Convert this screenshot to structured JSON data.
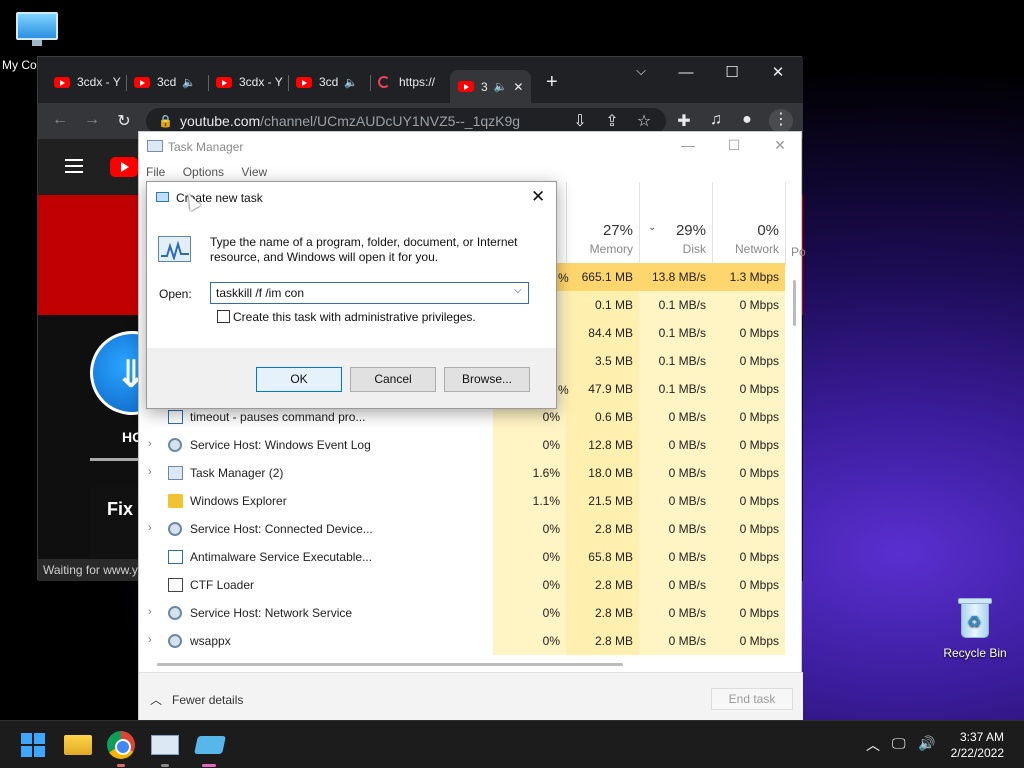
{
  "desktop": {
    "my_computer_label": "My Co",
    "recycle_bin_label": "Recycle Bin"
  },
  "chrome": {
    "tabs": [
      {
        "label": "3cdx - Y",
        "icon": "youtube-icon"
      },
      {
        "label": "3cd",
        "icon": "youtube-icon",
        "audio": true
      },
      {
        "label": "3cdx - Y",
        "icon": "youtube-icon"
      },
      {
        "label": "3cd",
        "icon": "youtube-icon",
        "audio": true
      },
      {
        "label": "https://",
        "icon": "loading-icon",
        "audio": true
      },
      {
        "label": "3",
        "icon": "youtube-icon",
        "audio": true,
        "active": true
      }
    ],
    "new_tab": "+",
    "url_host": "youtube.com",
    "url_path": "/channel/UCmzAUDcUY1NVZ5--_1qzK9g",
    "status_text": "Waiting for www.y",
    "yt_tab_home": "HO",
    "yt_video_title": "Fix Y"
  },
  "taskmgr": {
    "title": "Task Manager",
    "menu": [
      "File",
      "Options",
      "View"
    ],
    "columns": [
      {
        "pct": "27%",
        "label": "Memory"
      },
      {
        "pct": "29%",
        "label": "Disk"
      },
      {
        "pct": "0%",
        "label": "Network"
      }
    ],
    "extra_col": "Po",
    "rows": [
      {
        "name": "",
        "cpu": "",
        "mem": "665.1 MB",
        "disk": "13.8 MB/s",
        "net": "1.3 Mbps",
        "hot": true
      },
      {
        "name": "",
        "cpu": "",
        "mem": "0.1 MB",
        "disk": "0.1 MB/s",
        "net": "0 Mbps"
      },
      {
        "name": "",
        "cpu": "",
        "mem": "84.4 MB",
        "disk": "0.1 MB/s",
        "net": "0 Mbps"
      },
      {
        "name": "",
        "cpu": "",
        "mem": "3.5 MB",
        "disk": "0.1 MB/s",
        "net": "0 Mbps"
      },
      {
        "name": "",
        "cpu": "",
        "mem": "47.9 MB",
        "disk": "0.1 MB/s",
        "net": "0 Mbps"
      },
      {
        "name": "timeout - pauses command pro...",
        "cpu": "0%",
        "mem": "0.6 MB",
        "disk": "0 MB/s",
        "net": "0 Mbps",
        "exp": false,
        "icon": "console"
      },
      {
        "name": "Service Host: Windows Event Log",
        "cpu": "0%",
        "mem": "12.8 MB",
        "disk": "0 MB/s",
        "net": "0 Mbps",
        "exp": true,
        "icon": "gear"
      },
      {
        "name": "Task Manager (2)",
        "cpu": "1.6%",
        "mem": "18.0 MB",
        "disk": "0 MB/s",
        "net": "0 Mbps",
        "exp": true,
        "icon": "taskmgr"
      },
      {
        "name": "Windows Explorer",
        "cpu": "1.1%",
        "mem": "21.5 MB",
        "disk": "0 MB/s",
        "net": "0 Mbps",
        "exp": false,
        "icon": "folder"
      },
      {
        "name": "Service Host: Connected Device...",
        "cpu": "0%",
        "mem": "2.8 MB",
        "disk": "0 MB/s",
        "net": "0 Mbps",
        "exp": true,
        "icon": "gear"
      },
      {
        "name": "Antimalware Service Executable...",
        "cpu": "0%",
        "mem": "65.8 MB",
        "disk": "0 MB/s",
        "net": "0 Mbps",
        "exp": false,
        "icon": "console"
      },
      {
        "name": "CTF Loader",
        "cpu": "0%",
        "mem": "2.8 MB",
        "disk": "0 MB/s",
        "net": "0 Mbps",
        "exp": false,
        "icon": "ctf"
      },
      {
        "name": "Service Host: Network Service",
        "cpu": "0%",
        "mem": "2.8 MB",
        "disk": "0 MB/s",
        "net": "0 Mbps",
        "exp": true,
        "icon": "gear"
      },
      {
        "name": "wsappx",
        "cpu": "0%",
        "mem": "2.8 MB",
        "disk": "0 MB/s",
        "net": "0 Mbps",
        "exp": true,
        "icon": "gear"
      }
    ],
    "partial_cpu_first5": [
      "%",
      "",
      "",
      "",
      "%"
    ],
    "fewer_details": "Fewer details",
    "end_task": "End task"
  },
  "run_dialog": {
    "title": "Create new task",
    "description": "Type the name of a program, folder, document, or Internet resource, and Windows will open it for you.",
    "open_label": "Open:",
    "input_value": "taskkill /f /im con",
    "admin_checkbox_label": "Create this task with administrative privileges.",
    "admin_checked": false,
    "ok": "OK",
    "cancel": "Cancel",
    "browse": "Browse..."
  },
  "taskbar": {
    "time": "3:37 AM",
    "date": "2/22/2022"
  }
}
